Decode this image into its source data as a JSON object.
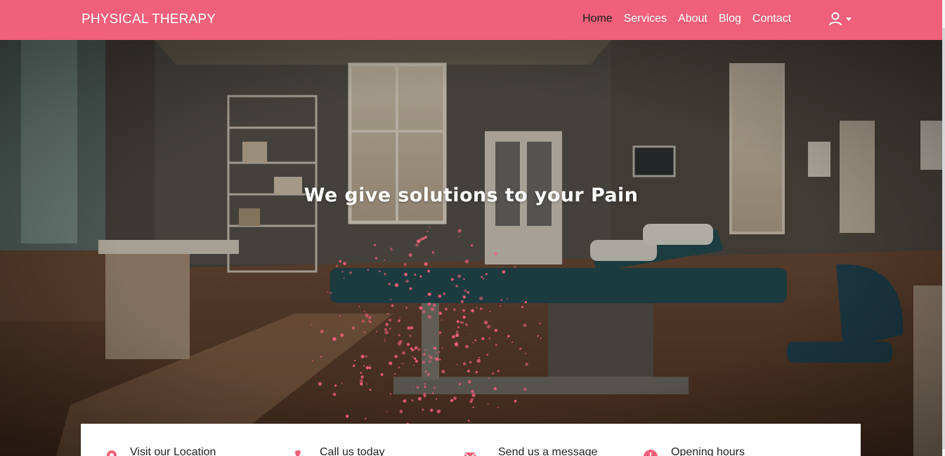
{
  "app": {
    "brand": "PHYSICAL THERAPY",
    "accent_color": "#f0607a"
  },
  "nav": {
    "items": [
      {
        "label": "Home",
        "active": true
      },
      {
        "label": "Services",
        "active": false
      },
      {
        "label": "About",
        "active": false
      },
      {
        "label": "Blog",
        "active": false
      },
      {
        "label": "Contact",
        "active": false
      }
    ],
    "user_icon": "user-icon"
  },
  "hero": {
    "title": "We give solutions to your Pain",
    "background": "therapy-room-photo"
  },
  "info": {
    "items": [
      {
        "label": "Visit our Location",
        "icon": "location-icon"
      },
      {
        "label": "Call us today",
        "icon": "phone-icon"
      },
      {
        "label": "Send us a message",
        "icon": "message-icon"
      },
      {
        "label": "Opening hours",
        "icon": "clock-icon"
      }
    ]
  }
}
